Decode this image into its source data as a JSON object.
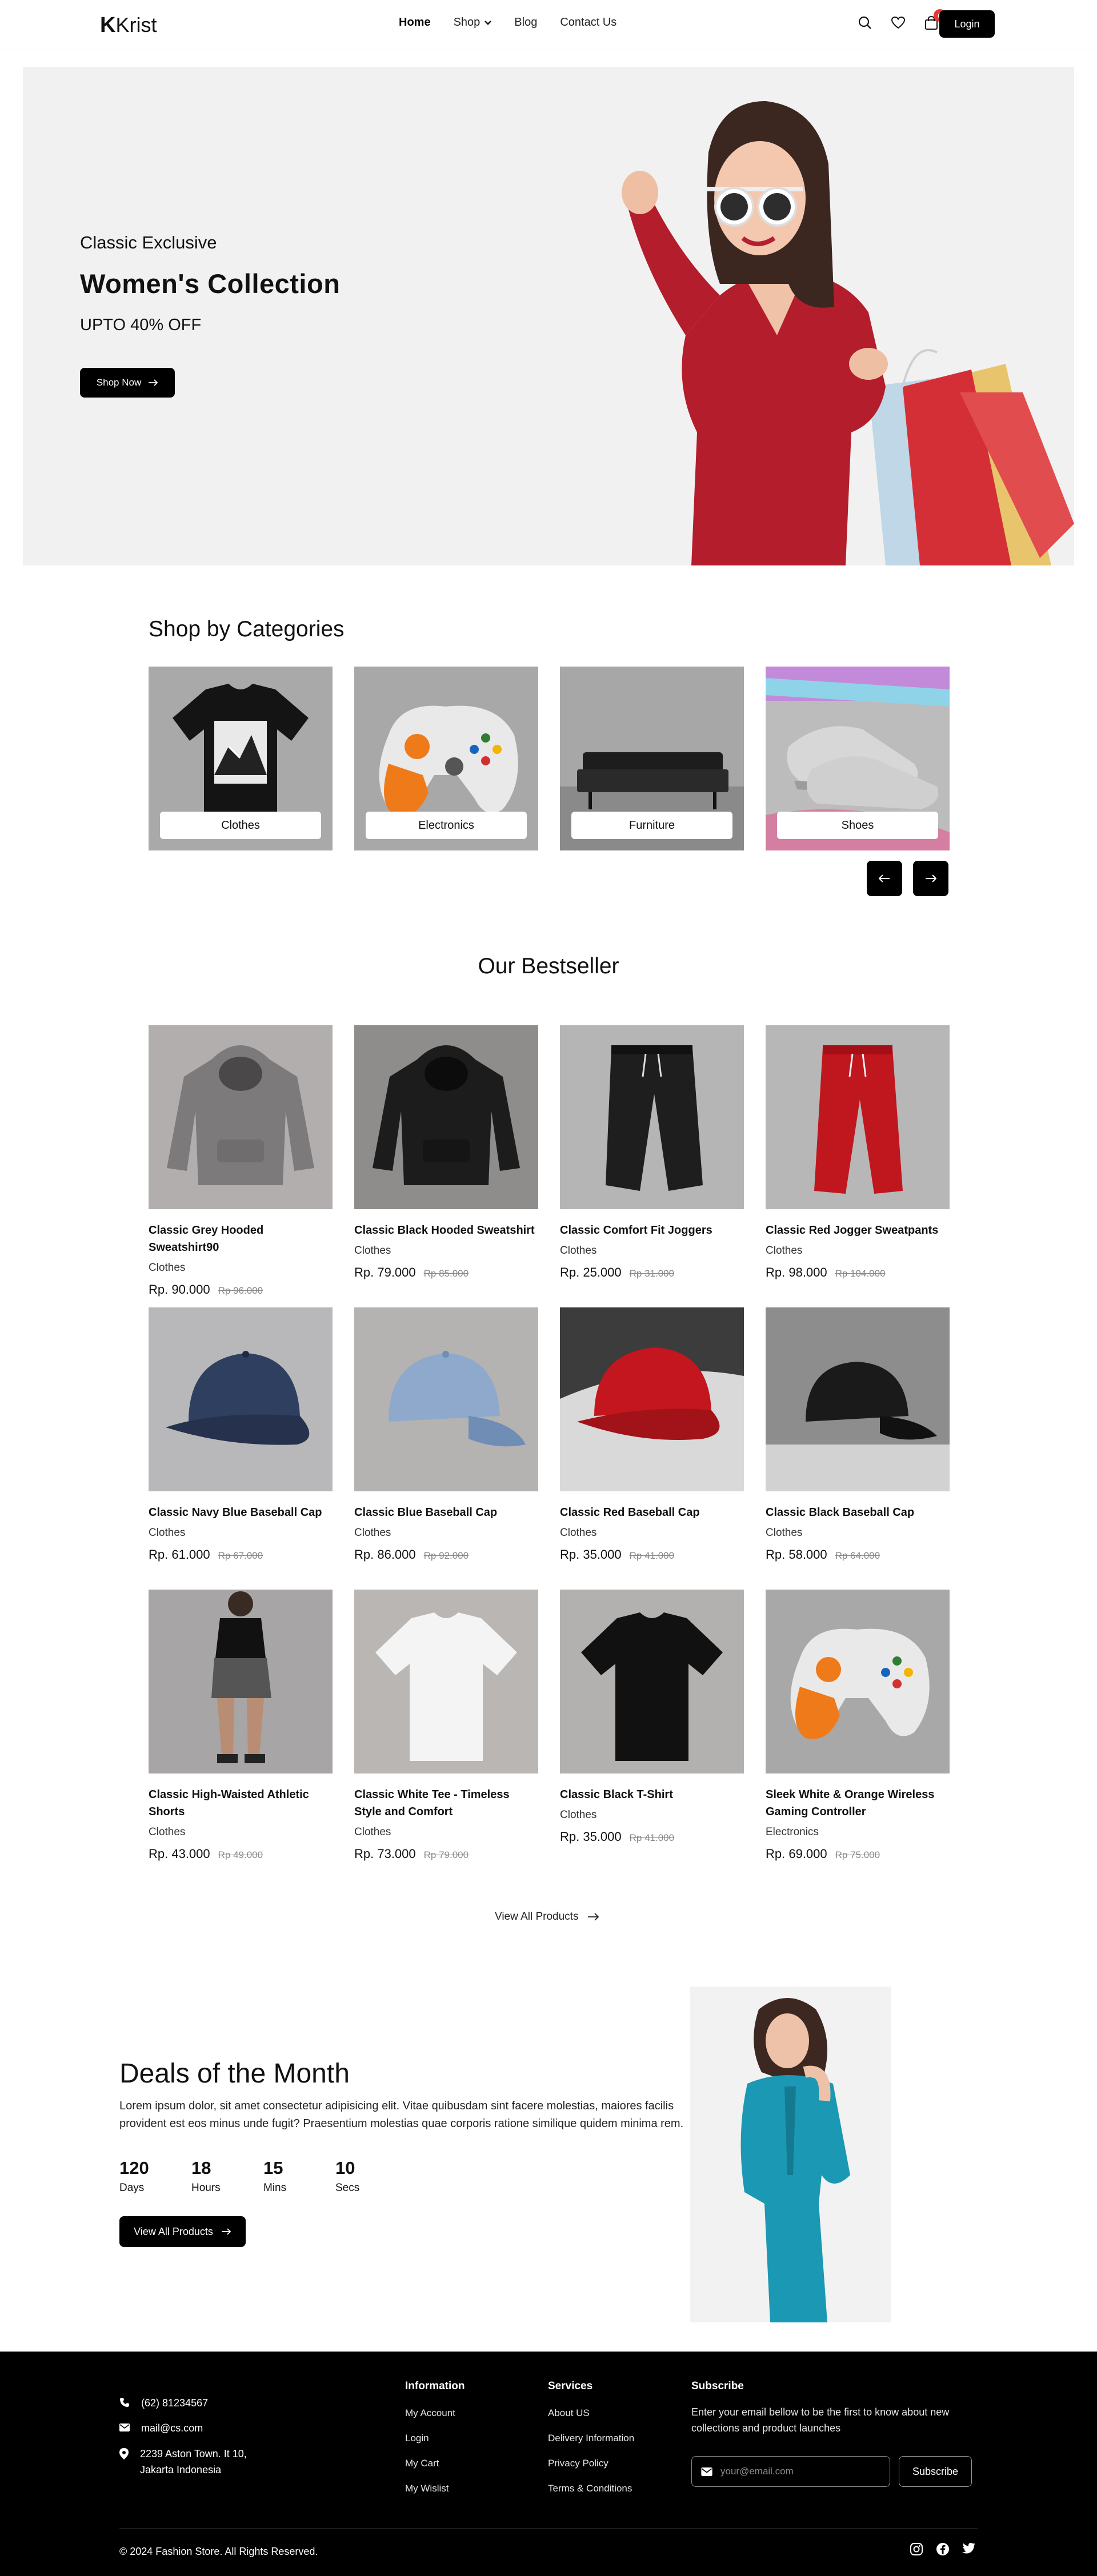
{
  "header": {
    "logo": "Krist",
    "nav": [
      {
        "label": "Home"
      },
      {
        "label": "Shop"
      },
      {
        "label": "Blog"
      },
      {
        "label": "Contact Us"
      }
    ],
    "cart_count": "0",
    "login_label": "Login"
  },
  "hero": {
    "eyebrow": "Classic Exclusive",
    "title": "Women's Collection",
    "subtitle": "UPTO 40% OFF",
    "button": "Shop Now"
  },
  "categories": {
    "title": "Shop by Categories",
    "items": [
      {
        "label": "Clothes"
      },
      {
        "label": "Electronics"
      },
      {
        "label": "Furniture"
      },
      {
        "label": "Shoes"
      }
    ]
  },
  "bestseller": {
    "title": "Our Bestseller",
    "products": [
      {
        "name": "Classic Grey Hooded Sweatshirt90",
        "category": "Clothes",
        "price": "Rp. 90.000",
        "old_price": "Rp 96.000"
      },
      {
        "name": "Classic Black Hooded Sweatshirt",
        "category": "Clothes",
        "price": "Rp. 79.000",
        "old_price": "Rp 85.000"
      },
      {
        "name": "Classic Comfort Fit Joggers",
        "category": "Clothes",
        "price": "Rp. 25.000",
        "old_price": "Rp 31.000"
      },
      {
        "name": "Classic Red Jogger Sweatpants",
        "category": "Clothes",
        "price": "Rp. 98.000",
        "old_price": "Rp 104.000"
      },
      {
        "name": "Classic Navy Blue Baseball Cap",
        "category": "Clothes",
        "price": "Rp. 61.000",
        "old_price": "Rp 67.000"
      },
      {
        "name": "Classic Blue Baseball Cap",
        "category": "Clothes",
        "price": "Rp. 86.000",
        "old_price": "Rp 92.000"
      },
      {
        "name": "Classic Red Baseball Cap",
        "category": "Clothes",
        "price": "Rp. 35.000",
        "old_price": "Rp 41.000"
      },
      {
        "name": "Classic Black Baseball Cap",
        "category": "Clothes",
        "price": "Rp. 58.000",
        "old_price": "Rp 64.000"
      },
      {
        "name": "Classic High-Waisted Athletic Shorts",
        "category": "Clothes",
        "price": "Rp. 43.000",
        "old_price": "Rp 49.000"
      },
      {
        "name": "Classic White Tee - Timeless Style and Comfort",
        "category": "Clothes",
        "price": "Rp. 73.000",
        "old_price": "Rp 79.000"
      },
      {
        "name": "Classic Black T-Shirt",
        "category": "Clothes",
        "price": "Rp. 35.000",
        "old_price": "Rp 41.000"
      },
      {
        "name": "Sleek White & Orange Wireless Gaming Controller",
        "category": "Electronics",
        "price": "Rp. 69.000",
        "old_price": "Rp 75.000"
      }
    ],
    "view_all": "View All Products"
  },
  "deals": {
    "title": "Deals of the Month",
    "text": "Lorem ipsum dolor, sit amet consectetur adipisicing elit. Vitae quibusdam sint facere molestias, maiores facilis provident est eos minus unde fugit? Praesentium molestias quae corporis ratione similique quidem minima rem.",
    "countdown": [
      {
        "value": "120",
        "unit": "Days"
      },
      {
        "value": "18",
        "unit": "Hours"
      },
      {
        "value": "15",
        "unit": "Mins"
      },
      {
        "value": "10",
        "unit": "Secs"
      }
    ],
    "button": "View All Products"
  },
  "footer": {
    "phone": "(62) 81234567",
    "email": "mail@cs.com",
    "address_line1": "2239 Aston Town. It 10,",
    "address_line2": "Jakarta Indonesia",
    "information": {
      "title": "Information",
      "links": [
        "My Account",
        "Login",
        "My Cart",
        "My Wislist"
      ]
    },
    "services": {
      "title": "Services",
      "links": [
        "About US",
        "Delivery Information",
        "Privacy Policy",
        "Terms & Conditions"
      ]
    },
    "subscribe": {
      "title": "Subscribe",
      "text": "Enter your email bellow to be the first to know about new collections and product launches",
      "placeholder": "your@email.com",
      "button": "Subscribe"
    },
    "copyright": "© 2024 Fashion Store. All Rights Reserved."
  },
  "colors": {
    "primary": "#000000",
    "badge": "#e53935",
    "hero_bg": "#f1f1f1",
    "deal_accent": "#1b98b3"
  }
}
